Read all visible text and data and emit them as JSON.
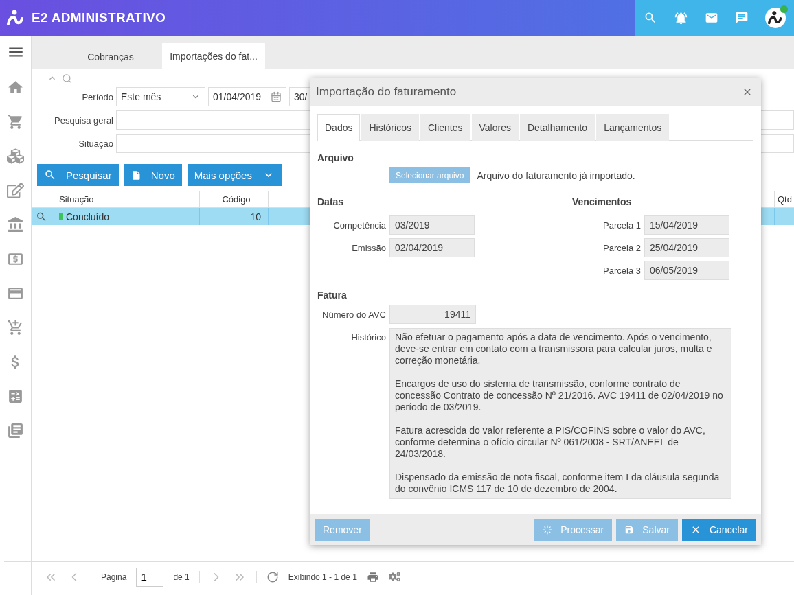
{
  "header": {
    "brand": "E2 ADMINISTRATIVO",
    "avatar_online": true
  },
  "tabs": [
    {
      "label": "Cobranças",
      "selected": false
    },
    {
      "label": "Importações do fat...",
      "selected": true
    }
  ],
  "filters": {
    "period_label": "Período",
    "period_value": "Este mês",
    "date_from": "01/04/2019",
    "date_to": "30/",
    "search_label": "Pesquisa geral",
    "situation_label": "Situação"
  },
  "actions": [
    "Pesquisar",
    "Novo",
    "Mais opções"
  ],
  "table": {
    "columns": [
      "Situação",
      "Código",
      "",
      "Qtd"
    ],
    "rows": [
      {
        "situacao": "Concluído",
        "codigo": "10",
        "color": "#3cc35b",
        "selected": true
      }
    ]
  },
  "dialog": {
    "title": "Importação do faturamento",
    "tabs": [
      {
        "label": "Dados",
        "selected": true
      },
      {
        "label": "Históricos",
        "selected": false
      },
      {
        "label": "Clientes",
        "selected": false
      },
      {
        "label": "Valores",
        "selected": false
      },
      {
        "label": "Detalhamento",
        "selected": false
      },
      {
        "label": "Lançamentos",
        "selected": false
      }
    ],
    "arquivo": {
      "heading": "Arquivo",
      "button": "Selecionar arquivo",
      "button_disabled": true,
      "note": "Arquivo do faturamento já importado."
    },
    "datas": {
      "heading": "Datas",
      "fields": [
        {
          "label": "Competência",
          "value": "03/2019"
        },
        {
          "label": "Emissão",
          "value": "02/04/2019"
        }
      ]
    },
    "vencimentos": {
      "heading": "Vencimentos",
      "fields": [
        {
          "label": "Parcela 1",
          "value": "15/04/2019"
        },
        {
          "label": "Parcela 2",
          "value": "25/04/2019"
        },
        {
          "label": "Parcela 3",
          "value": "06/05/2019"
        }
      ]
    },
    "fatura": {
      "heading": "Fatura",
      "avc_label": "Número do AVC",
      "avc_value": "19411",
      "historico_label": "Histórico",
      "historico": [
        "Não efetuar o pagamento após a data de vencimento. Após o vencimento, deve-se entrar em contato com a transmissora para calcular juros, multa e correção monetária.",
        "Encargos de uso do sistema de transmissão, conforme contrato de concessão Contrato de concessão Nº 21/2016. AVC 19411 de 02/04/2019 no período de 03/2019.",
        "Fatura acrescida do valor referente a PIS/COFINS sobre o valor do AVC, conforme determina o ofício circular Nº 061/2008 - SRT/ANEEL de 24/03/2018.",
        "Dispensado da emissão de nota fiscal, conforme item I da cláusula segunda do convênio ICMS 117 de 10 de dezembro de 2004."
      ]
    },
    "buttons": [
      {
        "kind": "remove",
        "label": "Remover",
        "disabled": true
      },
      {
        "kind": "process",
        "label": "Processar",
        "disabled": true
      },
      {
        "kind": "save",
        "label": "Salvar",
        "disabled": true
      },
      {
        "kind": "cancel",
        "label": "Cancelar",
        "disabled": false
      }
    ]
  },
  "pager": {
    "page_label": "Página",
    "page_value": "1",
    "of_label": "de 1",
    "showing": "Exibindo 1 - 1 de 1"
  }
}
